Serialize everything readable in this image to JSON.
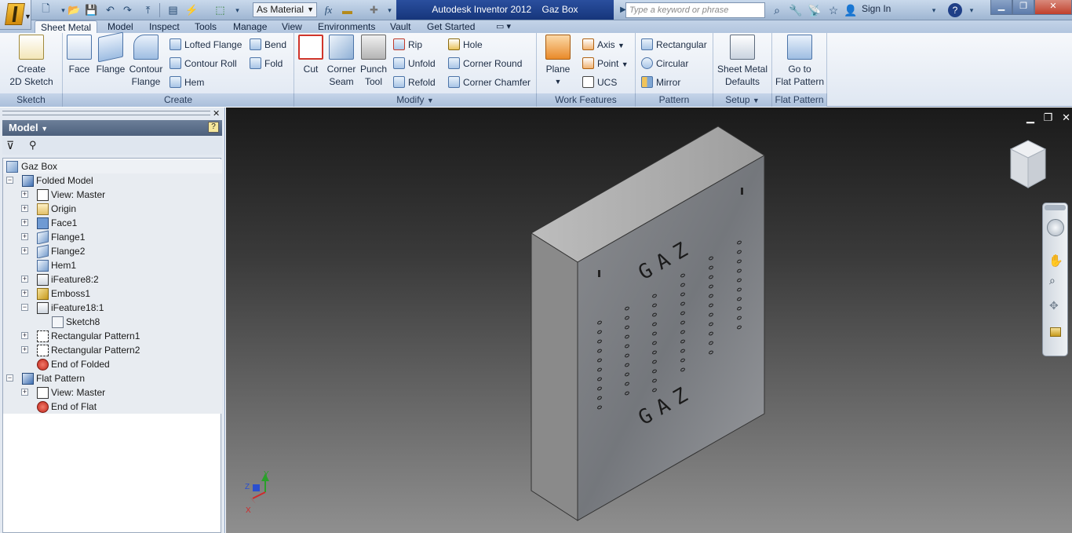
{
  "app": {
    "title": "Autodesk Inventor 2012",
    "document": "Gaz Box",
    "material": "As Material",
    "search_placeholder": "Type a keyword or phrase",
    "sign_in": "Sign In"
  },
  "tabs": [
    "Sheet Metal",
    "Model",
    "Inspect",
    "Tools",
    "Manage",
    "View",
    "Environments",
    "Vault",
    "Get Started"
  ],
  "ribbon": {
    "sketch": {
      "label": "Sketch",
      "create_2d_sketch_line1": "Create",
      "create_2d_sketch_line2": "2D Sketch"
    },
    "create": {
      "label": "Create",
      "face": "Face",
      "flange": "Flange",
      "contour_flange_line1": "Contour",
      "contour_flange_line2": "Flange",
      "lofted_flange": "Lofted Flange",
      "contour_roll": "Contour Roll",
      "hem": "Hem",
      "bend": "Bend",
      "fold": "Fold"
    },
    "modify": {
      "label": "Modify",
      "cut": "Cut",
      "corner_seam_line1": "Corner",
      "corner_seam_line2": "Seam",
      "punch_tool_line1": "Punch",
      "punch_tool_line2": "Tool",
      "rip": "Rip",
      "unfold": "Unfold",
      "refold": "Refold",
      "hole": "Hole",
      "corner_round": "Corner Round",
      "corner_chamfer": "Corner Chamfer"
    },
    "work_features": {
      "label": "Work Features",
      "plane": "Plane",
      "axis": "Axis",
      "point": "Point",
      "ucs": "UCS"
    },
    "pattern": {
      "label": "Pattern",
      "rectangular": "Rectangular",
      "circular": "Circular",
      "mirror": "Mirror"
    },
    "setup": {
      "label": "Setup",
      "sheet_metal_defaults_line1": "Sheet Metal",
      "sheet_metal_defaults_line2": "Defaults"
    },
    "flat_pattern": {
      "label": "Flat Pattern",
      "go_to_flat_pattern_line1": "Go to",
      "go_to_flat_pattern_line2": "Flat Pattern"
    }
  },
  "browser": {
    "title": "Model",
    "tree": [
      {
        "label": "Gaz Box",
        "icon": "part-icon"
      },
      {
        "label": "Folded Model",
        "icon": "folded-model-icon"
      },
      {
        "label": "View: Master",
        "icon": "view-icon"
      },
      {
        "label": "Origin",
        "icon": "folder-icon"
      },
      {
        "label": "Face1",
        "icon": "face-icon"
      },
      {
        "label": "Flange1",
        "icon": "flange-icon"
      },
      {
        "label": "Flange2",
        "icon": "flange-icon"
      },
      {
        "label": "Hem1",
        "icon": "hem-icon"
      },
      {
        "label": "iFeature8:2",
        "icon": "ifeature-icon"
      },
      {
        "label": "Emboss1",
        "icon": "emboss-icon"
      },
      {
        "label": "iFeature18:1",
        "icon": "ifeature-icon"
      },
      {
        "label": "Sketch8",
        "icon": "sketch-icon"
      },
      {
        "label": "Rectangular Pattern1",
        "icon": "rectangular-pattern-icon"
      },
      {
        "label": "Rectangular Pattern2",
        "icon": "rectangular-pattern-icon"
      },
      {
        "label": "End of Folded",
        "icon": "end-of-part-icon"
      },
      {
        "label": "Flat Pattern",
        "icon": "flat-pattern-icon"
      },
      {
        "label": "View: Master",
        "icon": "view-icon"
      },
      {
        "label": "End of Flat",
        "icon": "end-of-part-icon"
      }
    ]
  },
  "model": {
    "front_text_top": "GAZ",
    "front_text_bottom": "GAZ"
  },
  "triad": {
    "x": "X",
    "y": "Y",
    "z": "Z"
  },
  "colors": {
    "accent": "#1f3f87",
    "viewport_top": "#1a1a1a",
    "viewport_bottom": "#8f8f8f"
  }
}
